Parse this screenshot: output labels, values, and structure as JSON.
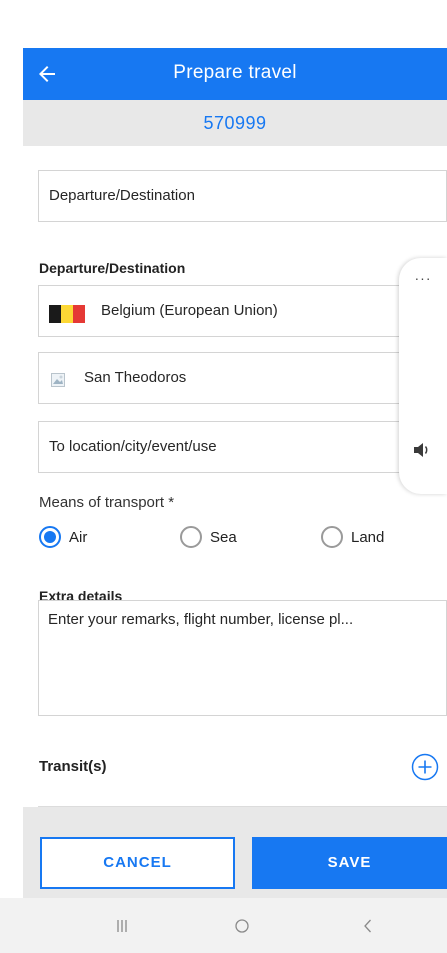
{
  "app_bar": {
    "title": "Prepare travel"
  },
  "travel_code": "570999",
  "departure_destination_field": "Departure/Destination",
  "departure_section": {
    "label": "Departure/Destination",
    "country": "Belgium (European Union)",
    "place": "San Theodoros",
    "to_location_placeholder": "To location/city/event/use"
  },
  "belgium_flag_colors": [
    "#1a1a1a",
    "#fdd835",
    "#e53935"
  ],
  "side_panel": {
    "menu_icon": "more-horizontal-icon",
    "volume_icon": "volume-icon",
    "dots": "···"
  },
  "transport": {
    "label": "Means of transport *",
    "options": [
      {
        "label": "Air",
        "selected": true
      },
      {
        "label": "Sea",
        "selected": false
      },
      {
        "label": "Land",
        "selected": false
      }
    ]
  },
  "extra_details": {
    "label": "Extra details",
    "placeholder": "Enter your remarks, flight number, license pl..."
  },
  "transit": {
    "label": "Transit(s)"
  },
  "footer": {
    "cancel": "CANCEL",
    "save": "SAVE"
  },
  "colors": {
    "accent": "#1778f2",
    "id_bar": "#e8e8e8"
  }
}
